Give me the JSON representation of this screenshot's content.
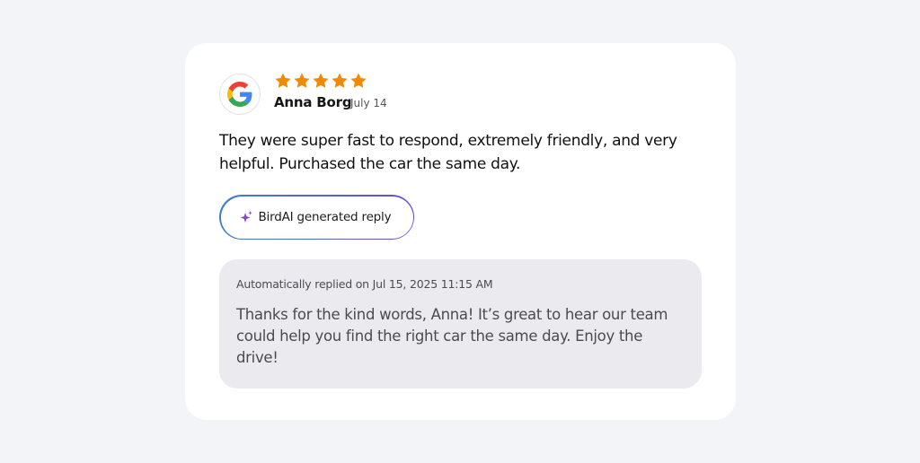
{
  "review": {
    "source_icon": "google-logo",
    "rating": 5,
    "reviewer_name": "Anna Borg",
    "date": "July 14",
    "text": "They were super fast to respond, extremely friendly, and very helpful. Purchased the car the same day.",
    "star_color": "#f08a00"
  },
  "ai_badge": {
    "label": "BirdAI generated reply",
    "icon": "sparkle-icon"
  },
  "reply": {
    "meta": "Automatically replied on Jul 15, 2025 11:15 AM",
    "text": "Thanks for the kind words, Anna! It’s great to hear our team could help you find the right car the same day. Enjoy the drive!"
  }
}
